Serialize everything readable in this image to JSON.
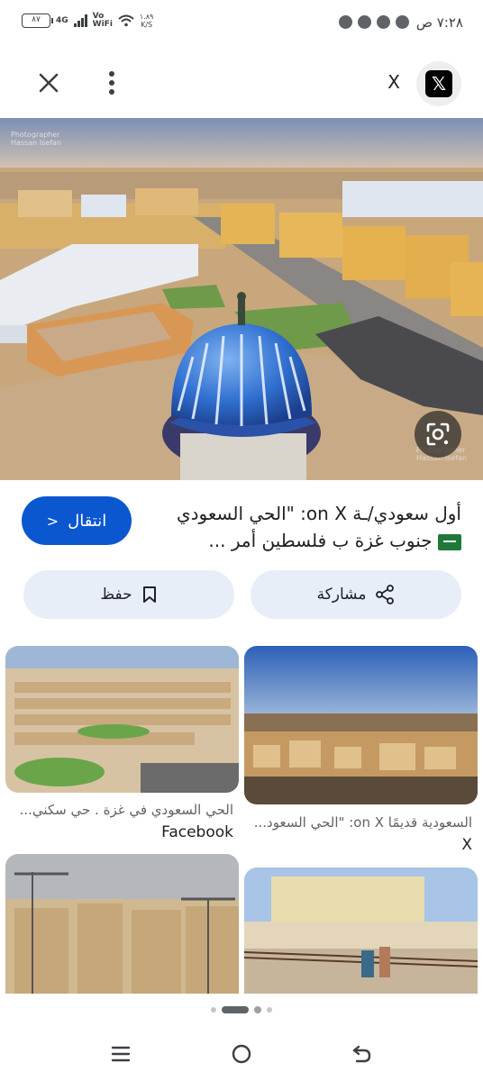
{
  "status_bar": {
    "time": "٧:٢٨ ص",
    "battery": "٨٧",
    "network": "4G",
    "volte_line1": "Vo",
    "volte_line2": "WiFi",
    "speed_value": "١.٨٩",
    "speed_unit": "K/S"
  },
  "topbar": {
    "site_name": "X",
    "logo_letter": "𝕏"
  },
  "hero": {
    "watermark_line1": "Photographer",
    "watermark_line2": "Hassan Isefan"
  },
  "result": {
    "title_line1": "أول سعودي/ـة on X: \"الحي السعودي",
    "title_line2": "جنوب غزة ب فلسطين أمر ...",
    "go_label": "انتقال"
  },
  "actions": {
    "share_label": "مشاركة",
    "save_label": "حفظ"
  },
  "related": [
    {
      "caption": "السعودية قديمًا on X: \"الحي السعود...",
      "source": "X"
    },
    {
      "caption": "الحي السعودي في غزة . حي سكني...",
      "source": "Facebook"
    },
    {
      "caption": "",
      "source": ""
    },
    {
      "caption": "",
      "source": ""
    }
  ],
  "colors": {
    "accent": "#0b57d0",
    "chip_bg": "#e8eef8"
  }
}
